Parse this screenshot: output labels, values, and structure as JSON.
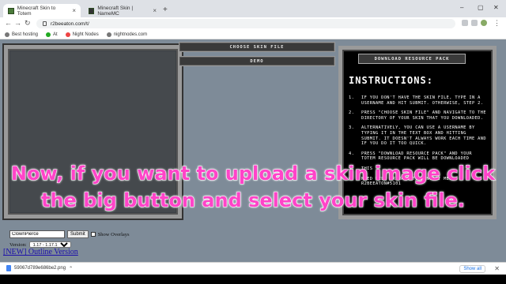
{
  "browser": {
    "tabs": [
      {
        "title": "Minecraft Skin to Totem",
        "active": true
      },
      {
        "title": "Minecraft Skin | NameMC",
        "active": false
      }
    ],
    "address": "r2beeaton.com/t/",
    "bookmarks": [
      "Best hosting",
      "At",
      "Night Nodes",
      "nightnodes.com"
    ]
  },
  "page": {
    "choose_skin_label": "CHOOSE SKIN FILE",
    "demo_label": "DEMO",
    "download_pack_label": "DOWNLOAD RESOURCE PACK",
    "instructions_title": "INSTRUCTIONS:",
    "instructions": [
      {
        "num": "1.",
        "text": "IF YOU DON'T HAVE THE SKIN FILE, TYPE IN A USERNAME AND HIT SUBMIT. OTHERWISE, STEP 2."
      },
      {
        "num": "2.",
        "text": "PRESS \"CHOOSE SKIN FILE\" AND NAVIGATE TO THE DIRECTORY OF YOUR SKIN THAT YOU DOWNLOADED."
      },
      {
        "num": "3.",
        "text": "ALTERNATIVELY, YOU CAN USE A USERNAME BY TYPING IT IN THE TEXT BOX AND HITTING SUBMIT. IT DOESN'T ALWAYS WORK EACH TIME AND IF YOU DO IT TOO QUICK."
      },
      {
        "num": "4.",
        "text": "PRESS \"DOWNLOAD RESOURCE PACK\" AND YOUR TOTEM RESOURCE PACK WILL BE DOWNLOADED"
      },
      {
        "num": "5.",
        "text": "THIS"
      },
      {
        "num": "6.",
        "text": "NEED HELP OR WANT TO CONTACT ME? R2BEEATON#5101"
      }
    ],
    "username_value": "ClownPierce",
    "submit_label": "Submit",
    "show_overlays_label": "Show Overlays",
    "version_label": "Version:",
    "version_selected": "1.17 - 1.17.1",
    "new_link": "[NEW] Outline Version",
    "caption_line1": "Now, if you want to upload a skin image click",
    "caption_line2": "the big button and select your skin file."
  },
  "downloads": {
    "file": "59067d789e686be2.png",
    "show_all": "Show all"
  }
}
